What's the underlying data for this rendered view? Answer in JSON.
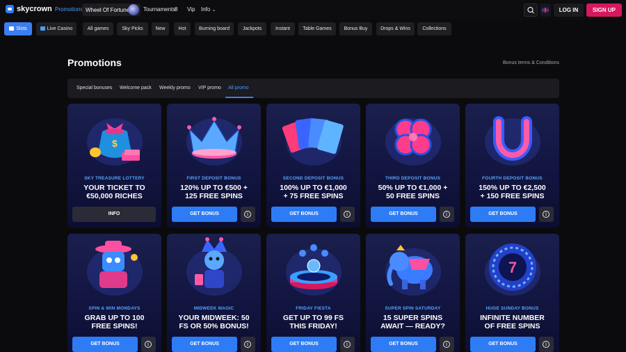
{
  "header": {
    "logo_text": "skycrown",
    "nav_promotions": "Promotions",
    "wheel_label": "Wheel Of Fortune",
    "nav_tournaments": "Tournaments",
    "tournaments_count": "8",
    "nav_vip": "Vip",
    "nav_info": "Info",
    "login_label": "LOG IN",
    "signup_label": "SIGN UP"
  },
  "categories": [
    "Slots",
    "Live Casino",
    "All games",
    "Sky Picks",
    "New",
    "Hot",
    "Burning board",
    "Jackpots",
    "Instant",
    "Table Games",
    "Bonus Buy",
    "Drops & Wins",
    "Collections"
  ],
  "page": {
    "title": "Promotions",
    "terms_link": "Bonus terms & Conditions"
  },
  "tabs": [
    "Special bonuses",
    "Welcome pack",
    "Weekly promo",
    "VIP promo",
    "All promo"
  ],
  "active_tab": "All promo",
  "cards": [
    {
      "subtitle": "SKY TREASURE LOTTERY",
      "headline": [
        "YOUR TICKET TO",
        "€50,000 RICHES"
      ],
      "button": "INFO"
    },
    {
      "subtitle": "FIRST DEPOSIT BONUS",
      "headline": [
        "120% UP TO €500 +",
        "125 FREE SPINS"
      ],
      "button": "GET BONUS"
    },
    {
      "subtitle": "SECOND DEPOSIT BONUS",
      "headline": [
        "100% UP TO €1,000",
        "+ 75 FREE SPINS"
      ],
      "button": "GET BONUS"
    },
    {
      "subtitle": "THIRD DEPOSIT BONUS",
      "headline": [
        "50% UP TO €1,000 +",
        "50 FREE SPINS"
      ],
      "button": "GET BONUS"
    },
    {
      "subtitle": "FOURTH DEPOSIT BONUS",
      "headline": [
        "150% UP TO €2,500",
        "+ 150 FREE SPINS"
      ],
      "button": "GET BONUS"
    },
    {
      "subtitle": "SPIN & WIN MONDAYS",
      "headline": [
        "GRAB UP TO 100",
        "FREE SPINS!"
      ],
      "button": "GET BONUS"
    },
    {
      "subtitle": "MIDWEEK MAGIC",
      "headline": [
        "YOUR MIDWEEK: 50",
        "FS OR 50% BONUS!"
      ],
      "button": "GET BONUS"
    },
    {
      "subtitle": "FRIDAY FIESTA",
      "headline": [
        "GET UP TO 99 FS",
        "THIS FRIDAY!"
      ],
      "button": "GET BONUS"
    },
    {
      "subtitle": "SUPER SPIN SATURDAY",
      "headline": [
        "15 SUPER SPINS",
        "AWAIT — READY?"
      ],
      "button": "GET BONUS"
    },
    {
      "subtitle": "HUGE SUNDAY BONUS",
      "headline": [
        "INFINITE NUMBER",
        "OF FREE SPINS"
      ],
      "button": "GET BONUS"
    }
  ],
  "sunday_wheel_number": "7",
  "colors": {
    "accent_blue": "#2d7cf5",
    "signup_pink": "#d6185e",
    "card_bg": "#141845",
    "subtitle_blue": "#56a6ff"
  },
  "icons": [
    "search-icon",
    "flag-uk-icon",
    "info-icon",
    "chevron-down-icon",
    "slots-icon",
    "live-casino-icon"
  ]
}
